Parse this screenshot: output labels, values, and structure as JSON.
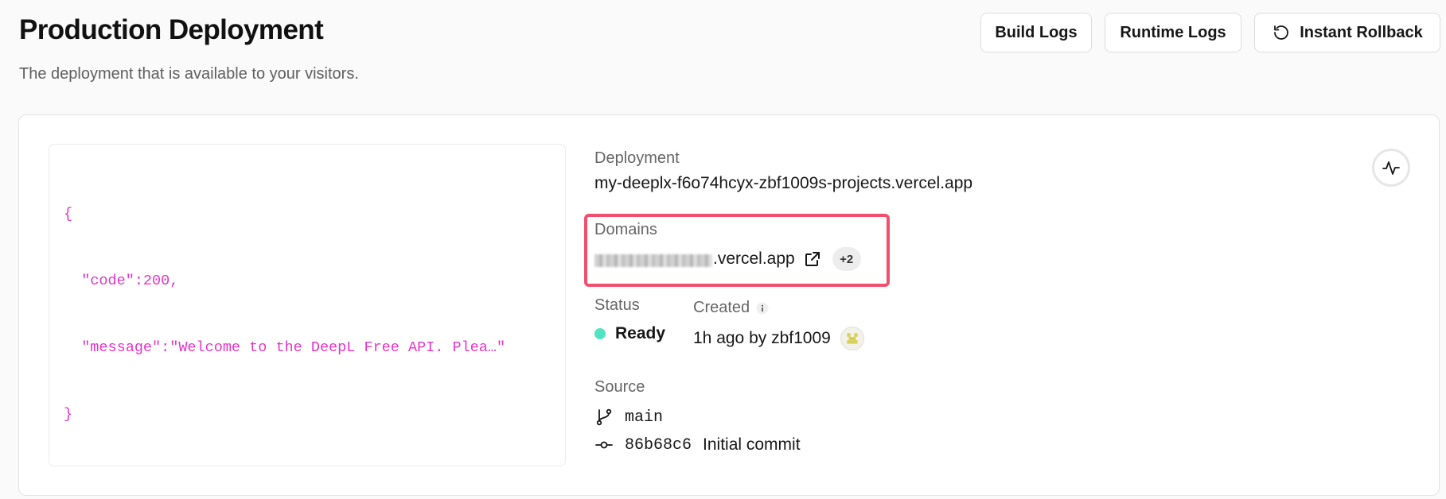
{
  "header": {
    "title": "Production Deployment",
    "subtitle": "The deployment that is available to your visitors."
  },
  "toolbar": {
    "build_logs_label": "Build Logs",
    "runtime_logs_label": "Runtime Logs",
    "rollback_label": "Instant Rollback"
  },
  "preview": {
    "lines": [
      "{",
      "  \"code\":200,",
      "  \"message\":\"Welcome to the DeepL Free API. Plea…\"",
      "}"
    ]
  },
  "deployment": {
    "label": "Deployment",
    "url": "my-deeplx-f6o74hcyx-zbf1009s-projects.vercel.app"
  },
  "domains": {
    "label": "Domains",
    "visible_suffix": ".vercel.app",
    "more_count": "+2",
    "highlight_color": "#f0506e"
  },
  "status": {
    "label": "Status",
    "value": "Ready",
    "color": "#50e3c2"
  },
  "created": {
    "label": "Created",
    "value": "1h ago by zbf1009"
  },
  "source": {
    "label": "Source",
    "branch": "main",
    "commit_hash": "86b68c6",
    "commit_message": "Initial commit"
  }
}
